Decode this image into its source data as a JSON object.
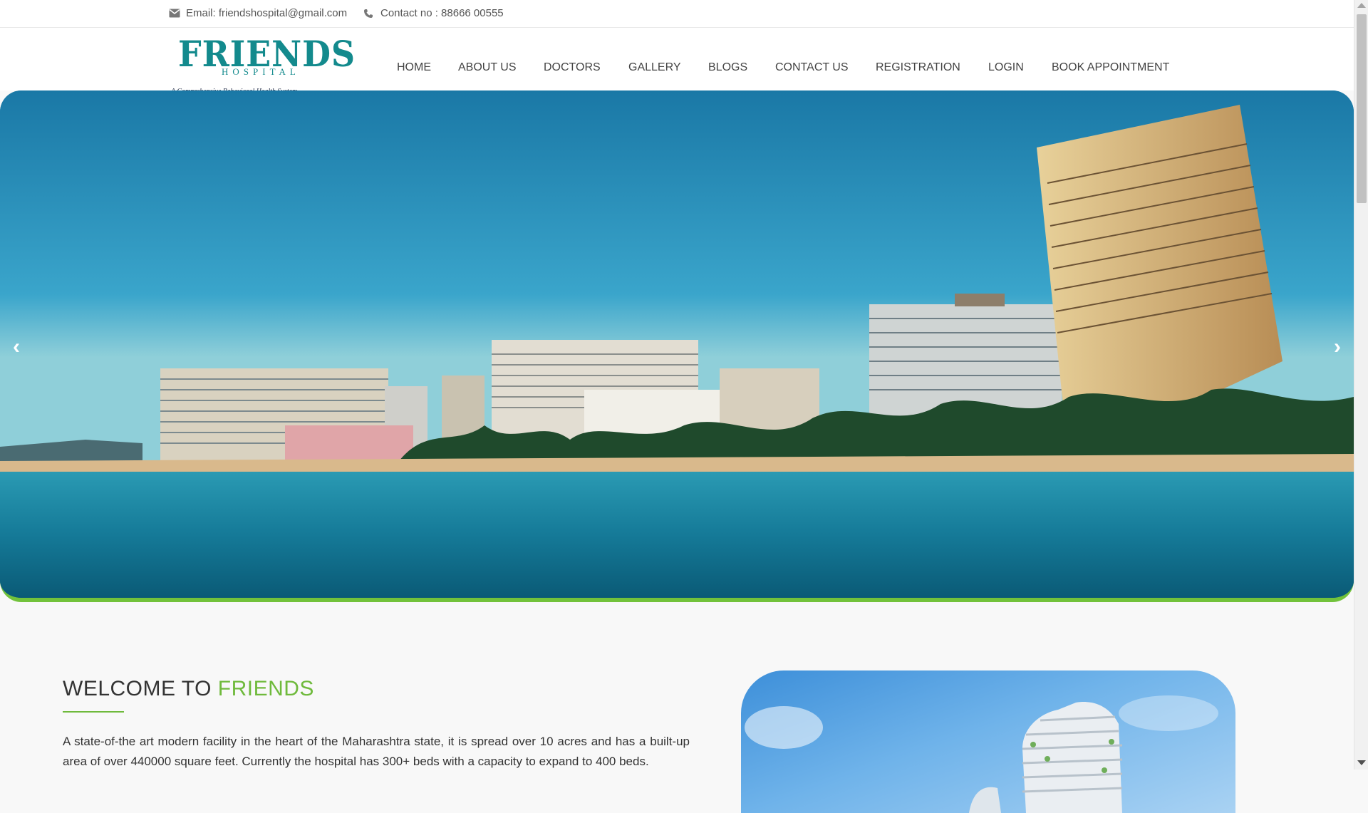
{
  "topbar": {
    "email": "Email: friendshospital@gmail.com",
    "contact": "Contact no : 88666 00555",
    "email_icon": "envelope-icon",
    "phone_icon": "phone-icon"
  },
  "logo": {
    "brand": "FRIENDS",
    "sub": "HOSPITAL",
    "tagline": "A Comprehensive Behavioral Health System",
    "color": "#138a8d"
  },
  "nav": {
    "items": [
      {
        "label": "HOME"
      },
      {
        "label": "ABOUT US"
      },
      {
        "label": "DOCTORS"
      },
      {
        "label": "GALLERY"
      },
      {
        "label": "BLOGS"
      },
      {
        "label": "CONTACT US"
      },
      {
        "label": "REGISTRATION"
      },
      {
        "label": "LOGIN"
      },
      {
        "label": "BOOK APPOINTMENT"
      }
    ]
  },
  "hero": {
    "prev_arrow": "‹",
    "next_arrow": "›",
    "accent_color": "#72c23b"
  },
  "welcome": {
    "title_prefix": "WELCOME TO ",
    "title_accent": "FRIENDS",
    "accent_color": "#6fba3c",
    "text": "A state-of-the art modern facility in the heart of the Maharashtra state, it is spread over 10 acres and has a built-up area of over 440000 square feet. Currently the hospital has 300+ beds with a capacity to expand to 400 beds."
  }
}
